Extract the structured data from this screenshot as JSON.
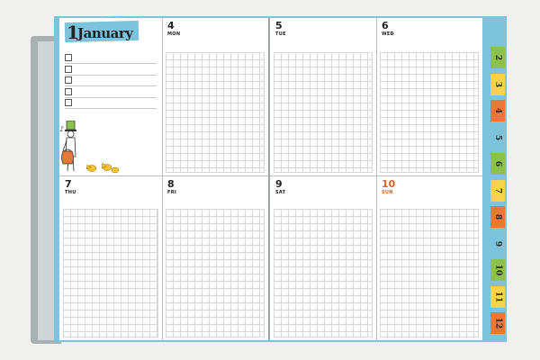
{
  "month": {
    "number": "1",
    "name": "January"
  },
  "todo_count": 5,
  "days_top": [
    {
      "num": "4",
      "name": "MON"
    },
    {
      "num": "5",
      "name": "TUE"
    },
    {
      "num": "6",
      "name": "WED"
    }
  ],
  "days_bottom": [
    {
      "num": "7",
      "name": "THU"
    },
    {
      "num": "8",
      "name": "FRI"
    },
    {
      "num": "9",
      "name": "SAT"
    },
    {
      "num": "10",
      "name": "SUN"
    }
  ],
  "tabs": [
    {
      "label": "2",
      "color": "#8cc152"
    },
    {
      "label": "3",
      "color": "#f5d34c"
    },
    {
      "label": "4",
      "color": "#e8773a"
    },
    {
      "label": "5",
      "color": "#7ec3dc"
    },
    {
      "label": "6",
      "color": "#8cc152"
    },
    {
      "label": "7",
      "color": "#f5d34c"
    },
    {
      "label": "8",
      "color": "#e8773a"
    },
    {
      "label": "9",
      "color": "#7ec3dc"
    },
    {
      "label": "10",
      "color": "#8cc152"
    },
    {
      "label": "11",
      "color": "#f5d34c"
    },
    {
      "label": "12",
      "color": "#e8773a"
    }
  ],
  "colors": {
    "accent_blue": "#7ec3dc",
    "sunday": "#e0612a"
  }
}
